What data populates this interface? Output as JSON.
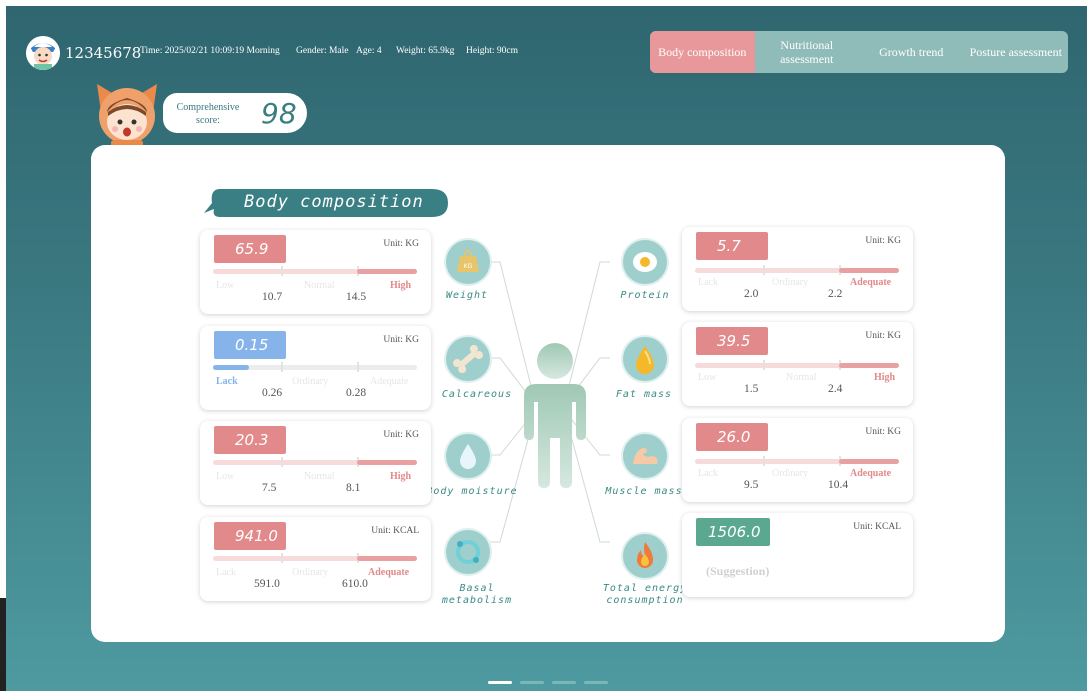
{
  "header": {
    "user_id": "12345678",
    "time": "Time: 2025/02/21 10:09:19 Morning",
    "gender": "Gender: Male",
    "age": "Age: 4",
    "weight": "Weight: 65.9kg",
    "height": "Height: 90cm"
  },
  "tabs": [
    {
      "label": "Body composition",
      "active": true
    },
    {
      "label": "Nutritional assessment",
      "active": false
    },
    {
      "label": "Growth trend",
      "active": false
    },
    {
      "label": "Posture assessment",
      "active": false
    }
  ],
  "score": {
    "label": "Comprehensive score:",
    "value": "98"
  },
  "section_title": "Body composition",
  "left_metrics": [
    {
      "value": "65.9",
      "unit": "Unit: KG",
      "labels": [
        "Low",
        "Normal",
        "High"
      ],
      "highlight": 2,
      "thresholds": [
        "10.7",
        "14.5"
      ],
      "value_color": "#e2898b",
      "bar_color": "#e8a0a2"
    },
    {
      "value": "0.15",
      "unit": "Unit: KG",
      "labels": [
        "Lack",
        "Ordinary",
        "Adequate"
      ],
      "highlight": 0,
      "thresholds": [
        "0.26",
        "0.28"
      ],
      "value_color": "#86b4ea",
      "bar_color": "#86b4ea"
    },
    {
      "value": "20.3",
      "unit": "Unit: KG",
      "labels": [
        "Low",
        "Normal",
        "High"
      ],
      "highlight": 2,
      "thresholds": [
        "7.5",
        "8.1"
      ],
      "value_color": "#e2898b",
      "bar_color": "#e8a0a2"
    },
    {
      "value": "941.0",
      "unit": "Unit: KCAL",
      "labels": [
        "Lack",
        "Ordinary",
        "Adequate"
      ],
      "highlight": 2,
      "thresholds": [
        "591.0",
        "610.0"
      ],
      "value_color": "#e2898b",
      "bar_color": "#e8a0a2"
    }
  ],
  "right_metrics": [
    {
      "value": "5.7",
      "unit": "Unit: KG",
      "labels": [
        "Lack",
        "Ordinary",
        "Adequate"
      ],
      "highlight": 2,
      "thresholds": [
        "2.0",
        "2.2"
      ],
      "value_color": "#e2898b",
      "bar_color": "#e8a0a2"
    },
    {
      "value": "39.5",
      "unit": "Unit: KG",
      "labels": [
        "Low",
        "Normal",
        "High"
      ],
      "highlight": 2,
      "thresholds": [
        "1.5",
        "2.4"
      ],
      "value_color": "#e2898b",
      "bar_color": "#e8a0a2"
    },
    {
      "value": "26.0",
      "unit": "Unit: KG",
      "labels": [
        "Lack",
        "Ordinary",
        "Adequate"
      ],
      "highlight": 2,
      "thresholds": [
        "9.5",
        "10.4"
      ],
      "value_color": "#e2898b",
      "bar_color": "#e8a0a2"
    },
    {
      "value": "1506.0",
      "unit": "Unit: KCAL",
      "suggestion": "(Suggestion)",
      "value_color": "#5aa88f"
    }
  ],
  "left_icons": [
    {
      "name": "weight-icon",
      "label": "Weight",
      "glyph": "KG"
    },
    {
      "name": "bone-icon",
      "label": "Calcareous",
      "glyph": "🦴"
    },
    {
      "name": "water-drop-icon",
      "label": "Body moisture",
      "glyph": "💧"
    },
    {
      "name": "metabolism-icon",
      "label": "Basal metabolism",
      "glyph": "⟲"
    }
  ],
  "right_icons": [
    {
      "name": "egg-icon",
      "label": "Protein",
      "glyph": "🍳"
    },
    {
      "name": "oil-drop-icon",
      "label": "Fat mass",
      "glyph": "💧"
    },
    {
      "name": "muscle-icon",
      "label": "Muscle mass",
      "glyph": "💪"
    },
    {
      "name": "flame-icon",
      "label": "Total energy consumption",
      "glyph": "🔥"
    }
  ],
  "colors": {
    "accent": "#3a7880",
    "active_tab": "#e8989a",
    "high": "#e2898b",
    "lack": "#86b4ea",
    "suggestion": "#5aa88f"
  }
}
